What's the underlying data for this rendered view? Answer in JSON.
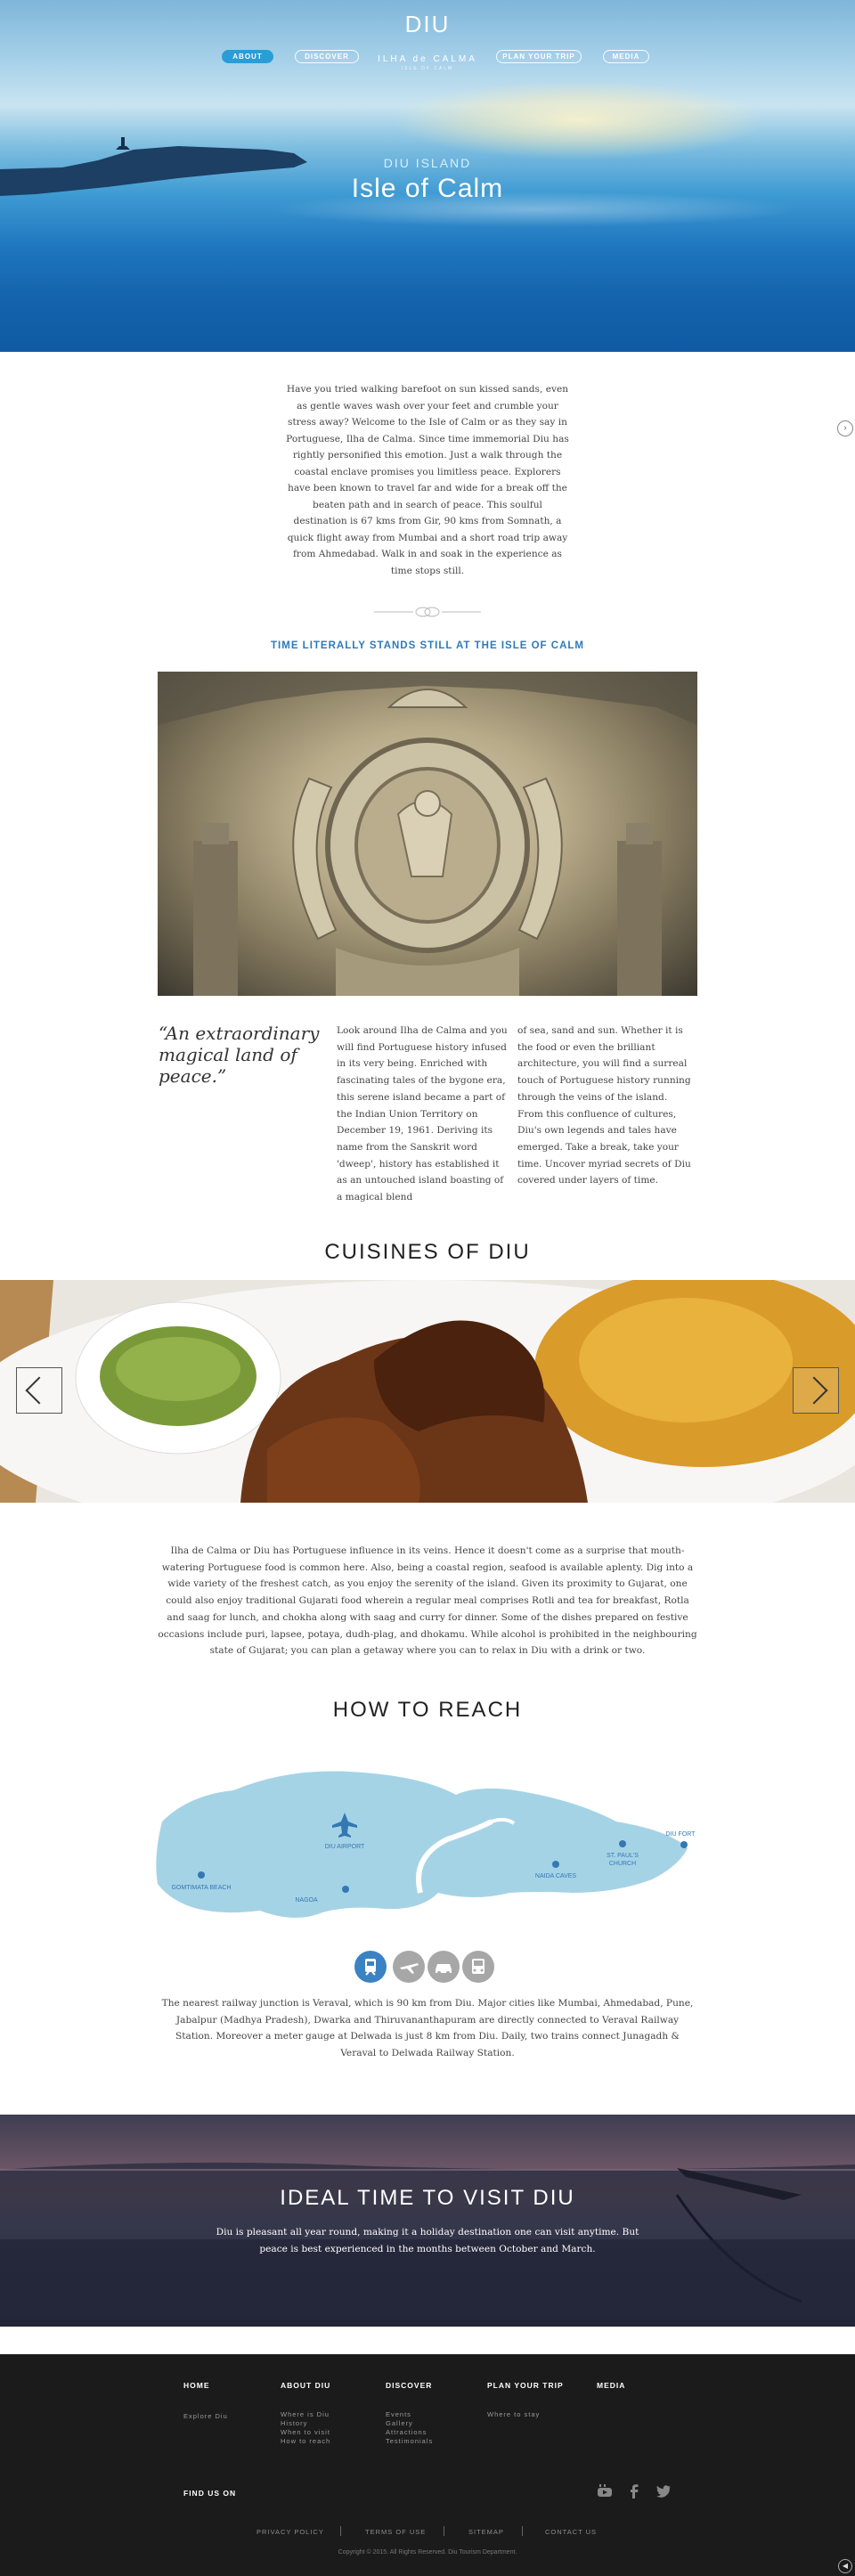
{
  "logo": {
    "title": "DIU",
    "subtitle": "ILHA de CALMA",
    "tagline": "ISLE OF CALM"
  },
  "nav": {
    "items": [
      {
        "label": "ABOUT",
        "active": true
      },
      {
        "label": "DISCOVER",
        "active": false
      },
      {
        "label": "PLAN YOUR TRIP",
        "active": false
      },
      {
        "label": "MEDIA",
        "active": false
      }
    ]
  },
  "hero": {
    "eyebrow": "DIU ISLAND",
    "title": "Isle of Calm"
  },
  "intro": {
    "text": "Have you tried walking barefoot on sun kissed sands, even as gentle waves wash over your feet and crumble your stress away? Welcome to the Isle of Calm or as they say in Portuguese, Ilha de Calma. Since time immemorial Diu has rightly personified this emotion. Just a walk through the coastal enclave promises you limitless peace. Explorers have been known to travel far and wide for a break off the beaten path and in search of peace. This soulful destination is 67 kms from Gir, 90 kms from Somnath, a quick flight away from Mumbai and a short road trip away from Ahmedabad. Walk in and soak in the experience as time stops still."
  },
  "tagline": "TIME LITERALLY STANDS STILL AT THE ISLE OF CALM",
  "about": {
    "quote": "“An extraordinary magical land of peace.”",
    "col1": "Look around Ilha de Calma and you will find Portuguese history infused in its very being. Enriched with fascinating tales of the bygone era, this serene island became a part of the Indian Union Territory on December 19, 1961. Deriving its name from the Sanskrit word 'dweep', history has established it as an untouched island boasting of a magical blend",
    "col2": "of sea, sand and sun. Whether it is the food or even the brilliant architecture, you will find a surreal touch of Portuguese history running through the veins of the island. From this confluence of cultures, Diu's own legends and tales have emerged. Take a break, take your time. Uncover myriad secrets of Diu covered under layers of time."
  },
  "cuisines": {
    "heading": "CUISINES OF DIU",
    "text": "Ilha de Calma or Diu has Portuguese influence in its veins. Hence it doesn't come as a surprise that mouth-watering Portuguese food is common here. Also, being a coastal region, seafood is available aplenty. Dig into a wide variety of the freshest catch, as you enjoy the serenity of the island. Given its proximity to Gujarat, one could also enjoy traditional Gujarati food wherein a regular meal comprises Rotli and tea for breakfast, Rotla and saag for lunch, and chokha along with saag and curry for dinner. Some of the dishes prepared on festive occasions include puri, lapsee, potaya, dudh-plag, and dhokamu. While alcohol is prohibited in the neighbouring state of Gujarat; you can plan a getaway where you can to relax in Diu with a drink or two."
  },
  "reach": {
    "heading": "HOW TO REACH",
    "map_labels": {
      "airport": "DIU AIRPORT",
      "fort": "DIU FORT",
      "church_line1": "ST. PAUL'S",
      "church_line2": "CHURCH",
      "caves": "NAIDA CAVES",
      "beach": "GOMTIMATA BEACH",
      "nagoa": "NAGOA"
    },
    "transport": [
      "train",
      "flight",
      "car",
      "bus"
    ],
    "text": "The nearest railway junction is Veraval, which is 90 km from Diu. Major cities like Mumbai, Ahmedabad, Pune, Jabalpur (Madhya Pradesh), Dwarka and Thiruvananthapuram are directly connected to Veraval Railway Station. Moreover a meter gauge at Delwada is just 8 km from Diu. Daily, two trains connect Junagadh & Veraval to Delwada Railway Station."
  },
  "ideal_time": {
    "heading": "IDEAL TIME TO VISIT DIU",
    "text": "Diu is pleasant all year round, making it a holiday destination one can visit anytime. But peace is best experienced in the months between October and March."
  },
  "footer": {
    "columns": [
      {
        "heading": "HOME",
        "links": [
          "Explore Diu"
        ]
      },
      {
        "heading": "ABOUT DIU",
        "links": [
          "Where is Diu",
          "History",
          "When to visit",
          "How to reach"
        ]
      },
      {
        "heading": "DISCOVER",
        "links": [
          "Events",
          "Gallery",
          "Attractions",
          "Testimonials"
        ]
      },
      {
        "heading": "PLAN YOUR TRIP",
        "links": [
          "Where to stay"
        ]
      },
      {
        "heading": "MEDIA",
        "links": []
      }
    ],
    "find_us": "FIND US ON",
    "social": [
      "youtube",
      "facebook",
      "twitter"
    ],
    "legal": [
      "PRIVACY POLICY",
      "TERMS OF USE",
      "SITEMAP",
      "CONTACT US"
    ],
    "copyright": "Copyright © 2015. All Rights Reserved. Diu Tourism Department."
  }
}
